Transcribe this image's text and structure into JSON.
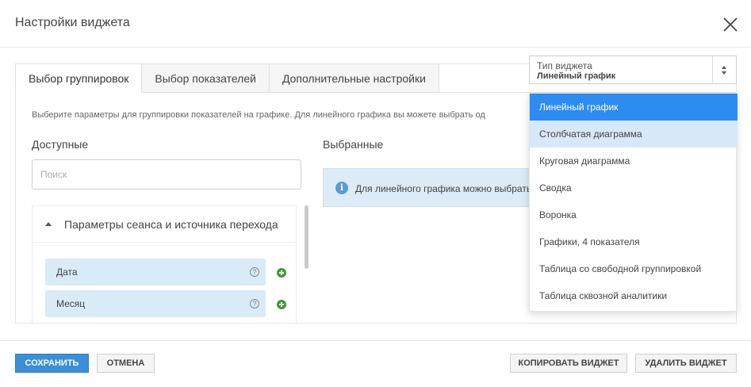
{
  "dialog": {
    "title": "Настройки виджета"
  },
  "tabs": [
    {
      "label": "Выбор группировок"
    },
    {
      "label": "Выбор показателей"
    },
    {
      "label": "Дополнительные настройки"
    }
  ],
  "content": {
    "description": "Выберите параметры для группировки показателей на графике. Для линейного графика вы можете выбрать од",
    "available_label": "Доступные",
    "selected_label": "Выбранные",
    "search_placeholder": "Поиск",
    "group_title": "Параметры сеанса и источника перехода",
    "items": [
      {
        "label": "Дата"
      },
      {
        "label": "Месяц"
      }
    ],
    "help_glyph": "?",
    "info_text": "Для линейного графика можно выбрать"
  },
  "widget_type": {
    "caption": "Тип виджета",
    "value": "Линейный график",
    "options": [
      {
        "label": "Линейный график",
        "state": "selected"
      },
      {
        "label": "Столбчатая диаграмма",
        "state": "hover"
      },
      {
        "label": "Круговая диаграмма",
        "state": ""
      },
      {
        "label": "Сводка",
        "state": ""
      },
      {
        "label": "Воронка",
        "state": ""
      },
      {
        "label": "Графики, 4 показателя",
        "state": ""
      },
      {
        "label": "Таблица со свободной группировкой",
        "state": ""
      },
      {
        "label": "Таблица сквозной аналитики",
        "state": ""
      }
    ]
  },
  "footer": {
    "save": "СОХРАНИТЬ",
    "cancel": "ОТМЕНА",
    "copy": "КОПИРОВАТЬ ВИДЖЕТ",
    "delete": "УДАЛИТЬ ВИДЖЕТ"
  },
  "colors": {
    "accent": "#3b8fd6",
    "option_selected": "#2d8cf0",
    "option_hover": "#d7e8f8",
    "item_bg": "#d9ebf7",
    "add_icon": "#3d9b35",
    "info_icon": "#5b9bd5"
  }
}
